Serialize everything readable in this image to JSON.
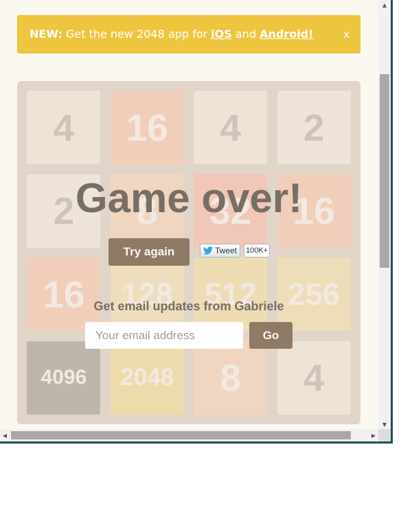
{
  "banner": {
    "new_label": "NEW:",
    "text_before": "Get the new 2048 app for",
    "ios_link": "iOS",
    "and_text": "and",
    "android_link": "Android!",
    "close_label": "x"
  },
  "board": {
    "tiles": [
      [
        "4",
        "16",
        "4",
        "2"
      ],
      [
        "2",
        "8",
        "32",
        "16"
      ],
      [
        "16",
        "128",
        "512",
        "256"
      ],
      [
        "4096",
        "2048",
        "8",
        "4"
      ]
    ]
  },
  "colors": {
    "tile_2": "#eee4da",
    "tile_4": "#ede0c8",
    "tile_8": "#f2b179",
    "tile_16": "#f59563",
    "tile_32": "#f67c5f",
    "tile_128": "#edcf72",
    "tile_256": "#edcc61",
    "tile_512": "#edc850",
    "tile_2048": "#edc22e",
    "tile_super": "#3c3a32",
    "banner": "#edc53f",
    "button": "#8f7a66"
  },
  "game_over": {
    "message": "Game over!",
    "try_again_label": "Try again",
    "tweet_label": "Tweet",
    "tweet_count": "100K+",
    "email_title": "Get email updates from Gabriele",
    "email_placeholder": "Your email address",
    "go_label": "Go"
  },
  "icons": {
    "twitter": "twitter-bird-icon",
    "scroll_up": "arrow-up-icon",
    "scroll_down": "arrow-down-icon",
    "scroll_left": "arrow-left-icon",
    "scroll_right": "arrow-right-icon"
  }
}
